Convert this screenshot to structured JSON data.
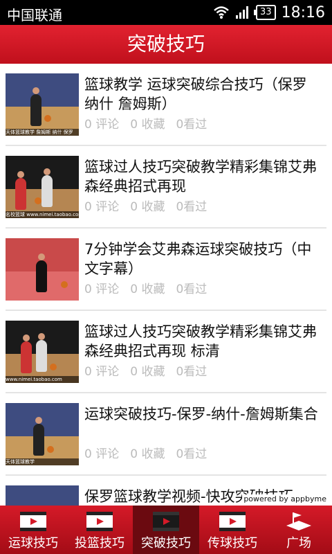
{
  "status": {
    "carrier": "中国联通",
    "battery": "33",
    "time": "18:16"
  },
  "header": {
    "title": "突破技巧"
  },
  "items": [
    {
      "title": "篮球教学  运球突破综合技巧（保罗 纳什 詹姆斯）",
      "comments": "0 评论",
      "favorites": "0 收藏",
      "views": "0看过",
      "thumb_caption": "天体篮球教学 詹姆斯 纳什 保罗"
    },
    {
      "title": "篮球过人技巧突破教学精彩集锦艾弗森经典招式再现",
      "comments": "0 评论",
      "favorites": "0 收藏",
      "views": "0看过",
      "thumb_caption": "名校篮球 www.nimei.taobao.com"
    },
    {
      "title": "7分钟学会艾弗森运球突破技巧（中文字幕）",
      "comments": "0 评论",
      "favorites": "0 收藏",
      "views": "0看过",
      "thumb_caption": ""
    },
    {
      "title": "篮球过人技巧突破教学精彩集锦艾弗森经典招式再现 标清",
      "comments": "0 评论",
      "favorites": "0 收藏",
      "views": "0看过",
      "thumb_caption": "www.nimei.taobao.com"
    },
    {
      "title": "运球突破技巧-保罗-纳什-詹姆斯集合",
      "comments": "0 评论",
      "favorites": "0 收藏",
      "views": "0看过",
      "thumb_caption": "天体篮球教学"
    },
    {
      "title": "保罗篮球教学视频-快攻突破技巧",
      "comments": "",
      "favorites": "",
      "views": "",
      "thumb_caption": ""
    }
  ],
  "powered_by": "powered by appbyme",
  "tabs": [
    {
      "label": "运球技巧",
      "icon": "film-play-icon"
    },
    {
      "label": "投篮技巧",
      "icon": "film-play-icon"
    },
    {
      "label": "突破技巧",
      "icon": "film-play-icon"
    },
    {
      "label": "传球技巧",
      "icon": "film-play-icon"
    },
    {
      "label": "广场",
      "icon": "plaza-flag-icon"
    }
  ],
  "active_tab": "突破技巧",
  "colors": {
    "brand_red": "#d51a28",
    "meta_gray": "#bbbbbb"
  }
}
